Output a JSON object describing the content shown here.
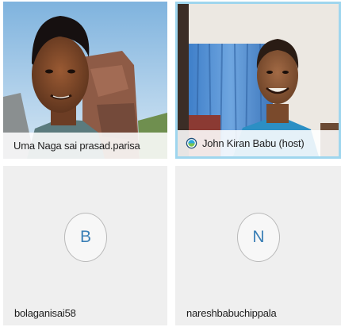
{
  "participants": [
    {
      "name": "Uma Naga sai prasad.parisa",
      "type": "video",
      "is_host": false
    },
    {
      "name": "John Kiran Babu (host)",
      "type": "video",
      "is_host": true,
      "badge_icon": "host-globe-icon",
      "active_speaker_color": "#9fd6ee"
    },
    {
      "name": "bolaganisai58",
      "type": "avatar",
      "initial": "B"
    },
    {
      "name": "nareshbabuchippala",
      "type": "avatar",
      "initial": "N"
    }
  ],
  "colors": {
    "tile_background": "#efefef",
    "avatar_letter": "#3a7fb6",
    "highlight_border": "#9fd6ee"
  }
}
